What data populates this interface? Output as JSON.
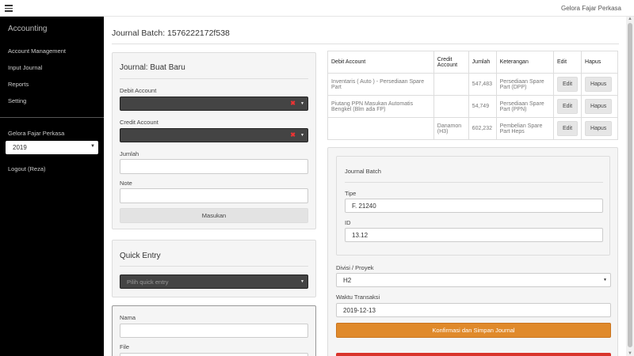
{
  "header": {
    "menu_icon": "hamburger-icon",
    "company": "Gelora Fajar Perkasa"
  },
  "sidebar": {
    "brand": "Accounting",
    "items": [
      {
        "label": "Account Management"
      },
      {
        "label": "Input Journal"
      },
      {
        "label": "Reports"
      },
      {
        "label": "Setting"
      }
    ],
    "company": "Gelora Fajar Perkasa",
    "year": "2019",
    "logout": "Logout (Reza)"
  },
  "page": {
    "title": "Journal Batch: 1576222172f538"
  },
  "journal_form": {
    "title": "Journal: Buat Baru",
    "debit_label": "Debit Account",
    "credit_label": "Credit Account",
    "jumlah_label": "Jumlah",
    "jumlah_value": "",
    "note_label": "Note",
    "note_value": "",
    "submit": "Masukan"
  },
  "quick_entry": {
    "title": "Quick Entry",
    "placeholder": "Pilih quick entry"
  },
  "file_form": {
    "nama_label": "Nama",
    "file_label": "File"
  },
  "table": {
    "headers": [
      "Debit Account",
      "Credit Account",
      "Jumlah",
      "Keterangan",
      "Edit",
      "Hapus"
    ],
    "rows": [
      {
        "debit": "Inventaris ( Auto ) - Persediaan Spare Part",
        "credit": "",
        "jumlah": "547,483",
        "keterangan": "Persediaan Spare Part (DPP)",
        "edit": "Edit",
        "hapus": "Hapus"
      },
      {
        "debit": "Piutang PPN Masukan Automatis Bengkel (Blm ada FP)",
        "credit": "",
        "jumlah": "54,749",
        "keterangan": "Persediaan Spare Part (PPN)",
        "edit": "Edit",
        "hapus": "Hapus"
      },
      {
        "debit": "",
        "credit": "Danamon (H3)",
        "jumlah": "602,232",
        "keterangan": "Pembelian Spare Part Heps",
        "edit": "Edit",
        "hapus": "Hapus"
      }
    ]
  },
  "batch": {
    "title": "Journal Batch",
    "tipe_label": "Tipe",
    "tipe_value": "F. 21240",
    "id_label": "ID",
    "id_value": "13.12",
    "divisi_label": "Divisi / Proyek",
    "divisi_value": "H2",
    "waktu_label": "Waktu Transaksi",
    "waktu_value": "2019-12-13",
    "confirm": "Konfirmasi dan Simpan Journal"
  },
  "colors": {
    "sidebar_bg": "#000000",
    "confirm_button": "#e08a2b",
    "danger_button": "#d9342b"
  }
}
